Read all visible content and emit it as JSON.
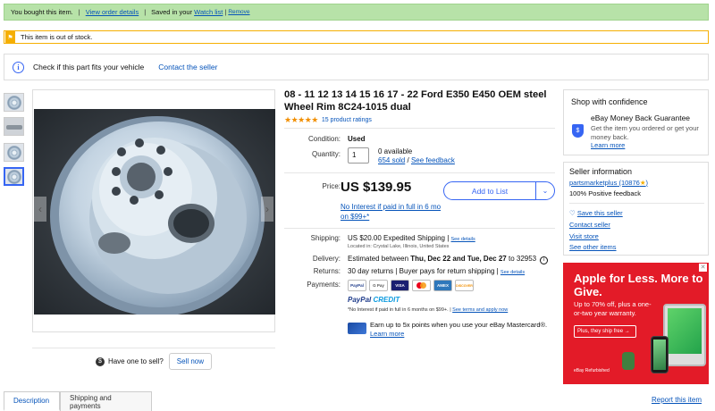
{
  "top_bar": {
    "bought": "You bought this item.",
    "sep1": "|",
    "view_order": "View order details",
    "sep2": "|",
    "saved_prefix": "Saved in your",
    "watch_list": "Watch list",
    "sep3": "|",
    "remove": "Remove"
  },
  "stock_alert": {
    "icon": "flag-icon",
    "text": "This item is out of stock."
  },
  "fits_bar": {
    "icon": "info-icon",
    "text": "Check if this part fits your vehicle",
    "contact": "Contact the seller"
  },
  "listing": {
    "title": "08 - 11 12 13 14 15 16 17 - 22 Ford E350 E450 OEM steel Wheel Rim 8C24-1015 dual",
    "stars": "★★★★★",
    "ratings": "15 product ratings",
    "condition_label": "Condition:",
    "condition_value": "Used",
    "quantity_label": "Quantity:",
    "quantity_value": "1",
    "available": "0 available",
    "sold": "654 sold",
    "sold_sep": "/",
    "feedback": "See feedback",
    "price_label": "Price:",
    "price": "US $139.95",
    "add_to_list": "Add to List",
    "no_interest": "No Interest if paid in full in 6 mo on $99+*",
    "shipping_label": "Shipping:",
    "shipping_value": "US $20.00 Expedited Shipping |",
    "see_details": "See details",
    "location": "Located in: Crystal Lake, Illinois, United States",
    "delivery_label": "Delivery:",
    "delivery_prefix": "Estimated between",
    "delivery_range": "Thu, Dec 22 and Tue, Dec 27",
    "delivery_zip": "to 32953",
    "returns_label": "Returns:",
    "returns_value": "30 day returns | Buyer pays for return shipping |",
    "returns_details": "See details",
    "payments_label": "Payments:",
    "payment_methods": [
      "PayPal",
      "G Pay",
      "VISA",
      "MC",
      "AMEX",
      "DISCOVER"
    ],
    "paypal_credit_a": "PayPal",
    "paypal_credit_b": "CREDIT",
    "credit_note": "*No Interest if paid in full in 6 months on $99+. |",
    "credit_terms": "See terms and apply now",
    "mc_text": "Earn up to 5x points when you use your eBay Mastercard®.",
    "mc_link": "Learn more"
  },
  "sell": {
    "question": "Have one to sell?",
    "button": "Sell now"
  },
  "tabs": [
    "Description",
    "Shipping and payments"
  ],
  "report": "Report this item",
  "confidence": {
    "heading": "Shop with confidence",
    "guarantee": "eBay Money Back Guarantee",
    "desc": "Get the item you ordered or get your money back.",
    "learn": "Learn more"
  },
  "seller": {
    "heading": "Seller information",
    "name": "partsmarketplus",
    "score": "(10876",
    "score_close": ")",
    "positive": "100% Positive feedback",
    "save": "Save this seller",
    "contact": "Contact seller",
    "visit": "Visit store",
    "other": "See other items"
  },
  "ad": {
    "headline": "Apple for Less. More to Give.",
    "sub": "Up to 70% off, plus a one-or-two year warranty.",
    "cta": "Plus, they ship free →",
    "brand": "eBay Refurbished"
  }
}
